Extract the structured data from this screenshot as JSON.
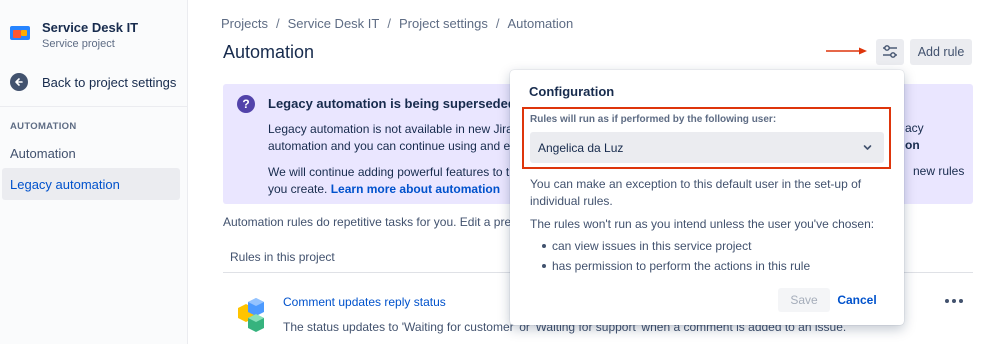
{
  "sidebar": {
    "project_name": "Service Desk IT",
    "project_type": "Service project",
    "back_label": "Back to project settings",
    "section_heading": "AUTOMATION",
    "items": [
      {
        "label": "Automation"
      },
      {
        "label": "Legacy automation"
      }
    ]
  },
  "header": {
    "breadcrumbs": [
      "Projects",
      "Service Desk IT",
      "Project settings",
      "Automation"
    ],
    "breadcrumb_separator": "/",
    "title": "Automation",
    "settings_icon": "sliders-icon",
    "add_rule_label": "Add rule"
  },
  "banner": {
    "icon": "?",
    "title": "Legacy automation is being superseded l",
    "line1": "Legacy automation is not available in new Jira S",
    "line2": "automation and you can continue using and edi",
    "line3": "We will continue adding powerful features to th",
    "line4_prefix": "you create.",
    "learn_more": "Learn more about automation",
    "right_line1": "acy",
    "right_line2": "on",
    "right_line3": "new rules"
  },
  "main": {
    "description": "Automation rules do repetitive tasks for you. Edit a pre-c",
    "rules_heading": "Rules in this project",
    "rule": {
      "name": "Comment updates reply status",
      "description": "The status updates to 'Waiting for customer' or 'Waiting for support' when a comment is added to an issue."
    }
  },
  "popup": {
    "title": "Configuration",
    "field_label": "Rules will run as if performed by the following user:",
    "selected_user": "Angelica da Luz",
    "exception_text_1": "You can make an exception to this default user in the set-up of",
    "exception_text_2": "individual rules.",
    "warning_text": "The rules won't run as you intend unless the user you've chosen:",
    "bullets": [
      "can view issues in this service project",
      "has permission to perform the actions in this rule"
    ],
    "save_label": "Save",
    "cancel_label": "Cancel"
  },
  "colors": {
    "accent": "#0052cc",
    "banner_bg": "#eae6ff",
    "highlight": "#de350b"
  }
}
